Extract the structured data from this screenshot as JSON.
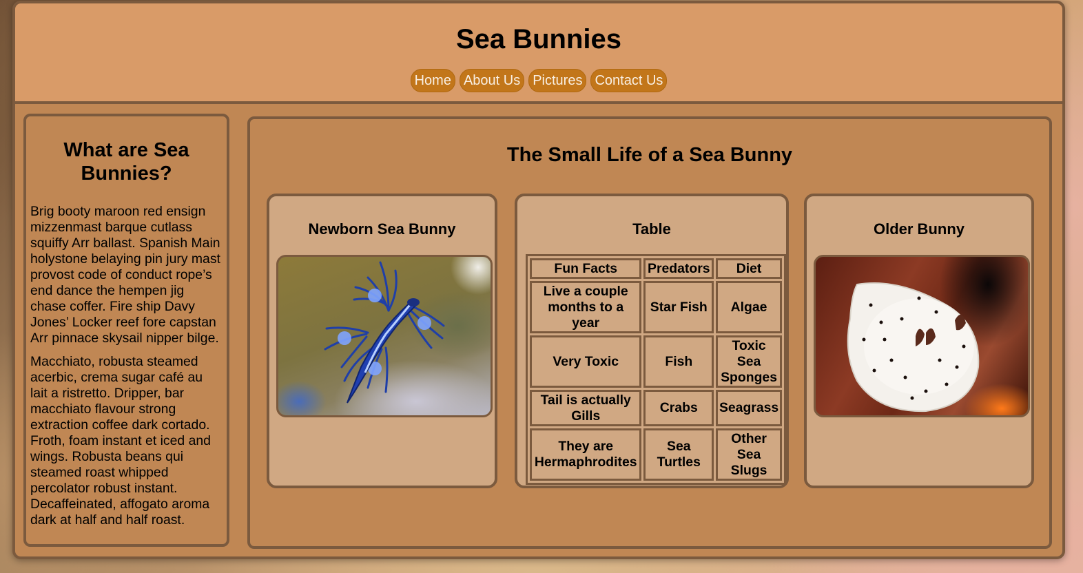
{
  "header": {
    "title": "Sea Bunnies",
    "nav": [
      "Home",
      "About Us",
      "Pictures",
      "Contact Us"
    ]
  },
  "sidebar": {
    "heading": "What are Sea Bunnies?",
    "paragraphs": [
      "Brig booty maroon red ensign mizzenmast barque cutlass squiffy Arr ballast. Spanish Main holystone belaying pin jury mast provost code of conduct rope’s end dance the hempen jig chase coffer. Fire ship Davy Jones’ Locker reef fore capstan Arr pinnace skysail nipper bilge.",
      "Macchiato, robusta steamed acerbic, crema sugar café au lait a ristretto. Dripper, bar macchiato flavour strong extraction coffee dark cortado. Froth, foam instant et iced and wings. Robusta beans qui steamed roast whipped percolator robust instant. Decaffeinated, affogato aroma dark at half and half roast."
    ]
  },
  "main": {
    "title": "The Small Life of a Sea Bunny",
    "cards": {
      "left": {
        "title": "Newborn Sea Bunny",
        "image": "blue-sea-slug-photo"
      },
      "middle": {
        "title": "Table"
      },
      "right": {
        "title": "Older Bunny",
        "image": "white-sea-bunny-photo"
      }
    },
    "table": {
      "headers": [
        "Fun Facts",
        "Predators",
        "Diet"
      ],
      "rows": [
        [
          "Live a couple months to a year",
          "Star Fish",
          "Algae"
        ],
        [
          "Very Toxic",
          "Fish",
          "Toxic Sea Sponges"
        ],
        [
          "Tail is actually Gills",
          "Crabs",
          "Seagrass"
        ],
        [
          "They are Hermaphrodites",
          "Sea Turtles",
          "Other Sea Slugs"
        ]
      ]
    }
  },
  "colors": {
    "header_bg": "#d99b68",
    "panel_bg": "#c08754",
    "card_bg": "#d0a883",
    "border": "#7b5a3e",
    "nav_button": "#c2761a",
    "nav_text": "#f9efe3"
  }
}
